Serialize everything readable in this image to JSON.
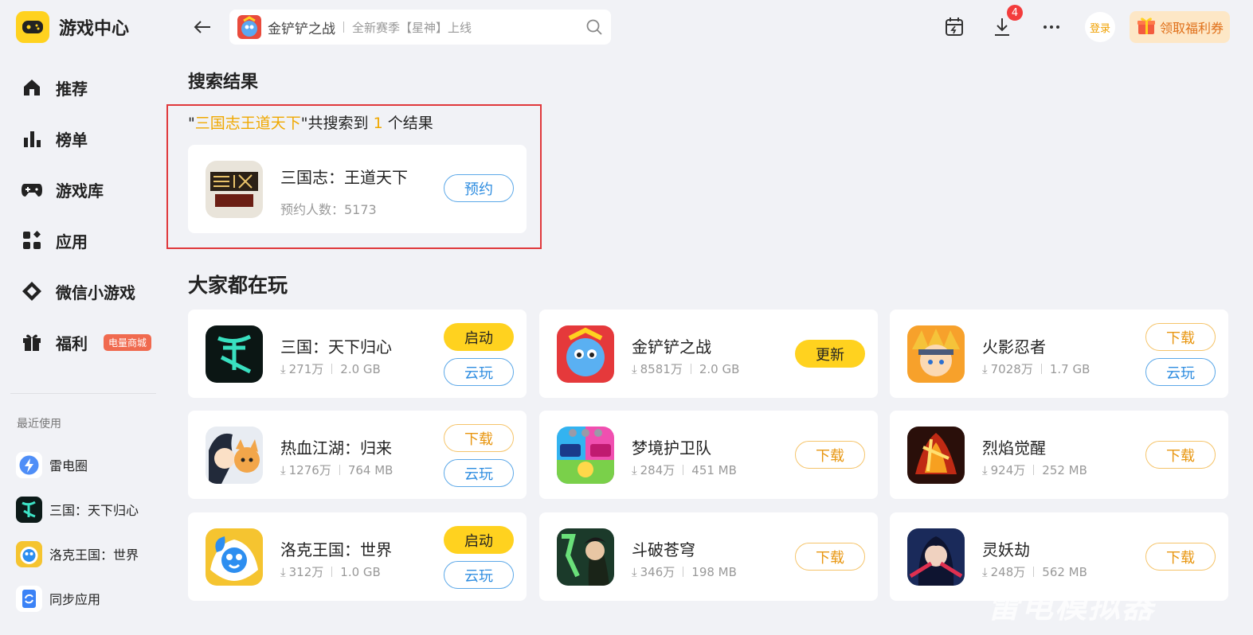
{
  "app": {
    "title": "游戏中心"
  },
  "nav": [
    {
      "label": "推荐",
      "icon": "home-icon"
    },
    {
      "label": "榜单",
      "icon": "chart-icon"
    },
    {
      "label": "游戏库",
      "icon": "gamepad-icon"
    },
    {
      "label": "应用",
      "icon": "apps-icon"
    },
    {
      "label": "微信小游戏",
      "icon": "diamond-icon"
    },
    {
      "label": "福利",
      "icon": "gift-icon",
      "badge": "电量商城"
    }
  ],
  "recent": {
    "title": "最近使用",
    "items": [
      {
        "label": "雷电圈"
      },
      {
        "label": "三国：天下归心"
      },
      {
        "label": "洛克王国：世界"
      },
      {
        "label": "同步应用"
      }
    ]
  },
  "search": {
    "game": "金铲铲之战",
    "hint": "全新赛季【星神】上线"
  },
  "topbar": {
    "download_count": "4",
    "login_label": "登录",
    "coupon_label": "领取福利券"
  },
  "results": {
    "title": "搜索结果",
    "quote_open": "\"",
    "query": "三国志王道天下",
    "mid_text": "\"共搜索到",
    "count": "1",
    "tail_text": "个结果",
    "item": {
      "name": "三国志：王道天下",
      "meta": "预约人数：5173",
      "button": "预约"
    }
  },
  "popular": {
    "title": "大家都在玩",
    "cards": [
      {
        "name": "三国：天下归心",
        "downloads": "271万",
        "size": "2.0 GB",
        "buttons": [
          "启动",
          "云玩"
        ]
      },
      {
        "name": "金铲铲之战",
        "downloads": "8581万",
        "size": "2.0 GB",
        "buttons": [
          "更新"
        ]
      },
      {
        "name": "火影忍者",
        "downloads": "7028万",
        "size": "1.7 GB",
        "buttons": [
          "下载",
          "云玩"
        ]
      },
      {
        "name": "热血江湖：归来",
        "downloads": "1276万",
        "size": "764 MB",
        "buttons": [
          "下载",
          "云玩"
        ]
      },
      {
        "name": "梦境护卫队",
        "downloads": "284万",
        "size": "451 MB",
        "buttons": [
          "下载"
        ]
      },
      {
        "name": "烈焰觉醒",
        "downloads": "924万",
        "size": "252 MB",
        "buttons": [
          "下载"
        ]
      },
      {
        "name": "洛克王国：世界",
        "downloads": "312万",
        "size": "1.0 GB",
        "buttons": [
          "启动",
          "云玩"
        ]
      },
      {
        "name": "斗破苍穹",
        "downloads": "346万",
        "size": "198 MB",
        "buttons": [
          "下载"
        ]
      },
      {
        "name": "灵妖劫",
        "downloads": "248万",
        "size": "562 MB",
        "buttons": [
          "下载"
        ]
      }
    ]
  },
  "watermark": "雷电模拟器",
  "colors": {
    "accent_yellow": "#ffd21f",
    "cloud_blue": "#2f8de0",
    "download_orange": "#e89610",
    "highlight_box": "#e0383b"
  }
}
